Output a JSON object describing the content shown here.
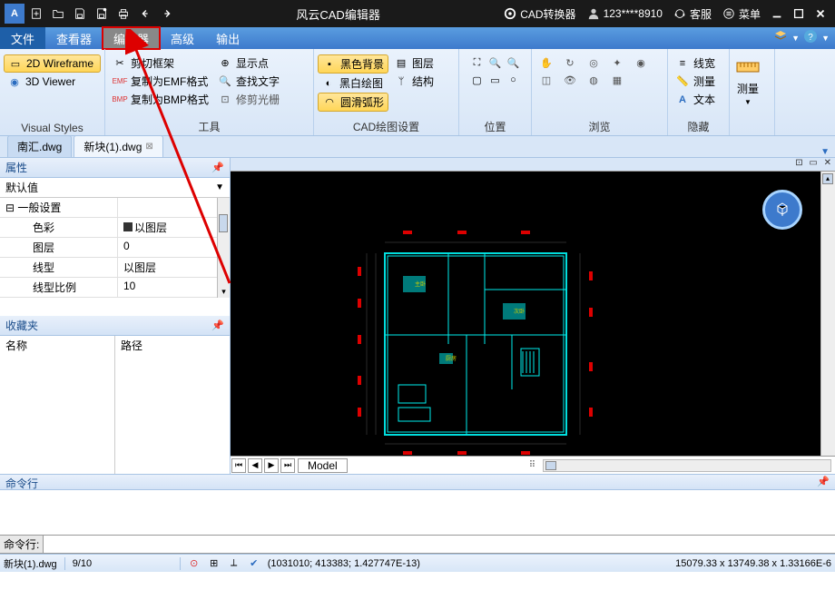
{
  "titlebar": {
    "app_title": "风云CAD编辑器",
    "converter_label": "CAD转换器",
    "user_id": "123****8910",
    "support_label": "客服",
    "menu_label": "菜单"
  },
  "menubar": {
    "items": [
      "文件",
      "查看器",
      "编辑器",
      "高级",
      "输出"
    ],
    "active_index": 0,
    "highlighted_index": 2
  },
  "ribbon": {
    "group_visual": {
      "wireframe_2d": "2D Wireframe",
      "viewer_3d": "3D Viewer",
      "label": "Visual Styles"
    },
    "group_tools": {
      "cut_frame": "剪切框架",
      "copy_emf": "复制为EMF格式",
      "copy_bmp": "复制为BMP格式",
      "show_point": "显示点",
      "find_text": "查找文字",
      "trim_raster": "修剪光栅",
      "label": "工具"
    },
    "group_cad": {
      "black_bg": "黑色背景",
      "bw_draw": "黑白绘图",
      "arc_smooth": "圆滑弧形",
      "layers": "图层",
      "structure": "结构",
      "label": "CAD绘图设置"
    },
    "group_position": {
      "label": "位置"
    },
    "group_browse": {
      "label": "浏览"
    },
    "group_hidden": {
      "lineweight": "线宽",
      "measure": "测量",
      "text": "文本",
      "label": "隐藏"
    },
    "group_measure_big": {
      "label": "测量"
    }
  },
  "doctabs": {
    "tabs": [
      {
        "label": "南汇.dwg",
        "active": false
      },
      {
        "label": "新块(1).dwg",
        "active": true
      }
    ]
  },
  "properties": {
    "panel_title": "属性",
    "default_label": "默认值",
    "section_general": "一般设置",
    "rows": [
      {
        "key": "色彩",
        "val": "以图层",
        "swatch": true
      },
      {
        "key": "图层",
        "val": "0"
      },
      {
        "key": "线型",
        "val": "以图层"
      },
      {
        "key": "线型比例",
        "val": "10"
      }
    ]
  },
  "favorites": {
    "panel_title": "收藏夹",
    "col_name": "名称",
    "col_path": "路径"
  },
  "canvas": {
    "model_tab": "Model"
  },
  "command": {
    "panel_title": "命令行",
    "prompt_label": "命令行:"
  },
  "statusbar": {
    "filename": "新块(1).dwg",
    "ratio": "9/10",
    "coords": "(1031010; 413383; 1.427747E-13)",
    "dims": "15079.33 x 13749.38 x 1.33166E-6"
  }
}
